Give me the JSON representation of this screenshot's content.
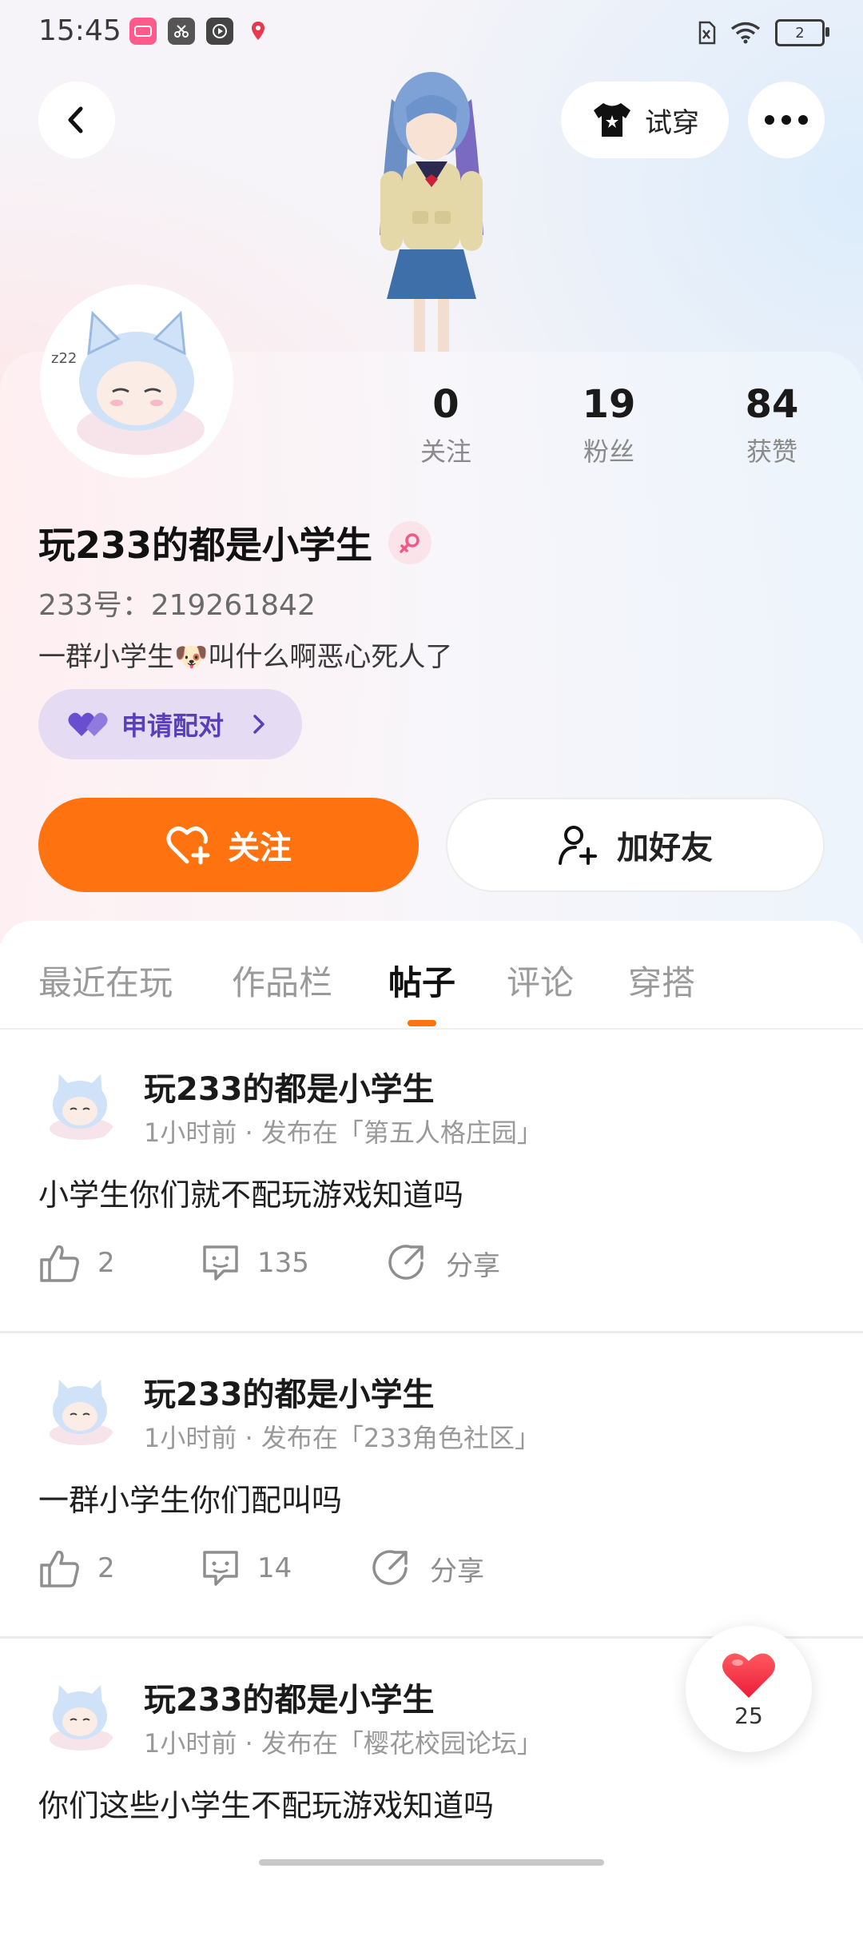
{
  "status_bar": {
    "time": "15:45",
    "battery": "2",
    "app_icons": [
      "pink-app-icon",
      "scissors-app-icon",
      "play-app-icon",
      "map-pin-app-icon"
    ]
  },
  "header": {
    "back_icon": "chevron-left-icon",
    "try_on_label": "试穿",
    "more_icon": "more-dots-icon"
  },
  "profile": {
    "stats": [
      {
        "value": "0",
        "label": "关注"
      },
      {
        "value": "19",
        "label": "粉丝"
      },
      {
        "value": "84",
        "label": "获赞"
      }
    ],
    "username": "玩233的都是小学生",
    "uid": "233号：219261842",
    "bio": "一群小学生🐶叫什么啊恶心死人了",
    "pair_label": "申请配对",
    "follow_label": "关注",
    "add_friend_label": "加好友"
  },
  "tabs": [
    {
      "label": "最近在玩",
      "active": false
    },
    {
      "label": "作品栏",
      "active": false
    },
    {
      "label": "帖子",
      "active": true
    },
    {
      "label": "评论",
      "active": false
    },
    {
      "label": "穿搭",
      "active": false
    }
  ],
  "posts": [
    {
      "author": "玩233的都是小学生",
      "meta": "1小时前 · 发布在「第五人格庄园」",
      "text": "小学生你们就不配玩游戏知道吗",
      "likes": "2",
      "comments": "135",
      "share": "分享"
    },
    {
      "author": "玩233的都是小学生",
      "meta": "1小时前 · 发布在「233角色社区」",
      "text": "一群小学生你们配叫吗",
      "likes": "2",
      "comments": "14",
      "share": "分享"
    },
    {
      "author": "玩233的都是小学生",
      "meta": "1小时前 · 发布在「樱花校园论坛」",
      "text": "你们这些小学生不配玩游戏知道吗",
      "likes": "",
      "comments": "",
      "share": ""
    }
  ],
  "floating_like": {
    "count": "25"
  },
  "colors": {
    "accent": "#ff7210",
    "pair_bg": "#e5dcf3",
    "pair_text": "#5840b8"
  }
}
